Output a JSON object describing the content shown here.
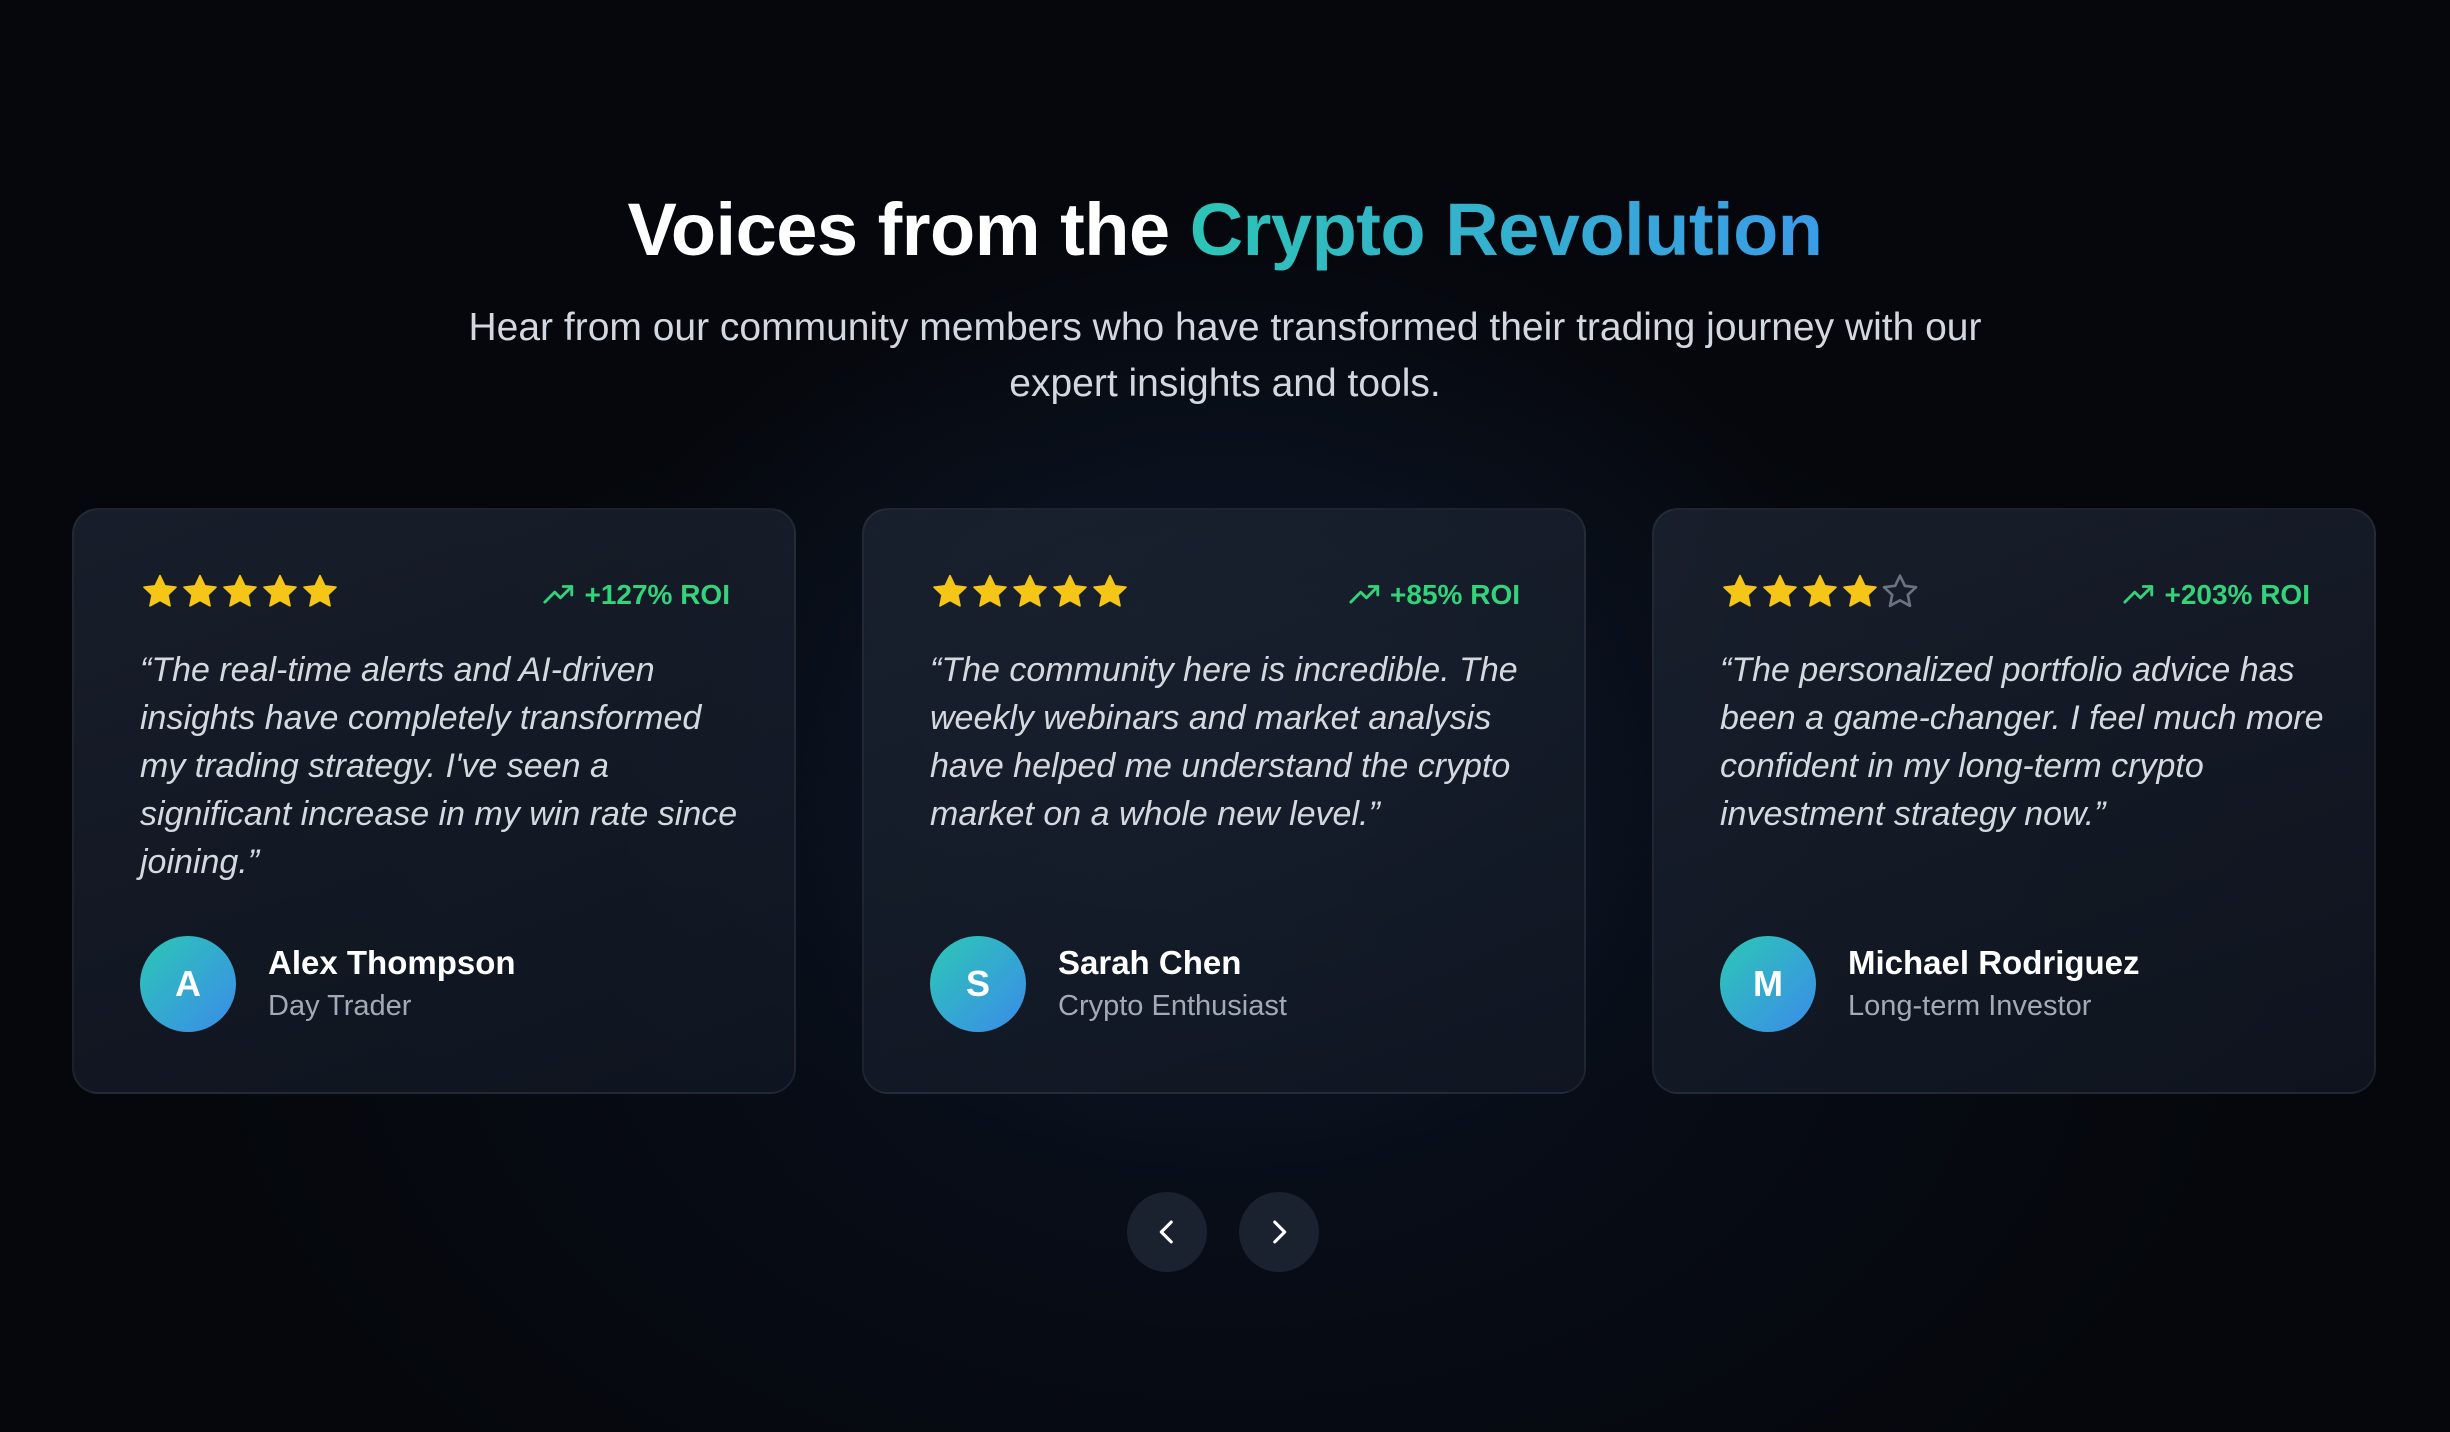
{
  "header": {
    "title_plain": "Voices from the ",
    "title_accent": "Crypto Revolution",
    "subtitle": "Hear from our community members who have transformed their trading journey with our expert insights and tools."
  },
  "testimonials": [
    {
      "rating": 5,
      "max_rating": 5,
      "roi": "+127% ROI",
      "quote": "“The real-time alerts and AI-driven insights have completely transformed my trading strategy. I've seen a significant increase in my win rate since joining.”",
      "initial": "A",
      "name": "Alex Thompson",
      "role": "Day Trader"
    },
    {
      "rating": 5,
      "max_rating": 5,
      "roi": "+85% ROI",
      "quote": "“The community here is incredible. The weekly webinars and market analysis have helped me understand the crypto market on a whole new level.”",
      "initial": "S",
      "name": "Sarah Chen",
      "role": "Crypto Enthusiast"
    },
    {
      "rating": 4,
      "max_rating": 5,
      "roi": "+203% ROI",
      "quote": "“The personalized portfolio advice has been a game-changer. I feel much more confident in my long-term crypto investment strategy now.”",
      "initial": "M",
      "name": "Michael Rodriguez",
      "role": "Long-term Investor"
    }
  ],
  "icons": {
    "star": "star-icon",
    "roi": "trending-up-icon",
    "prev": "chevron-left-icon",
    "next": "chevron-right-icon"
  },
  "colors": {
    "background": "#05070c",
    "accent_start": "#2ec4b6",
    "accent_end": "#3b9be8",
    "star_filled": "#f5c518",
    "roi_green": "#34d27b"
  }
}
